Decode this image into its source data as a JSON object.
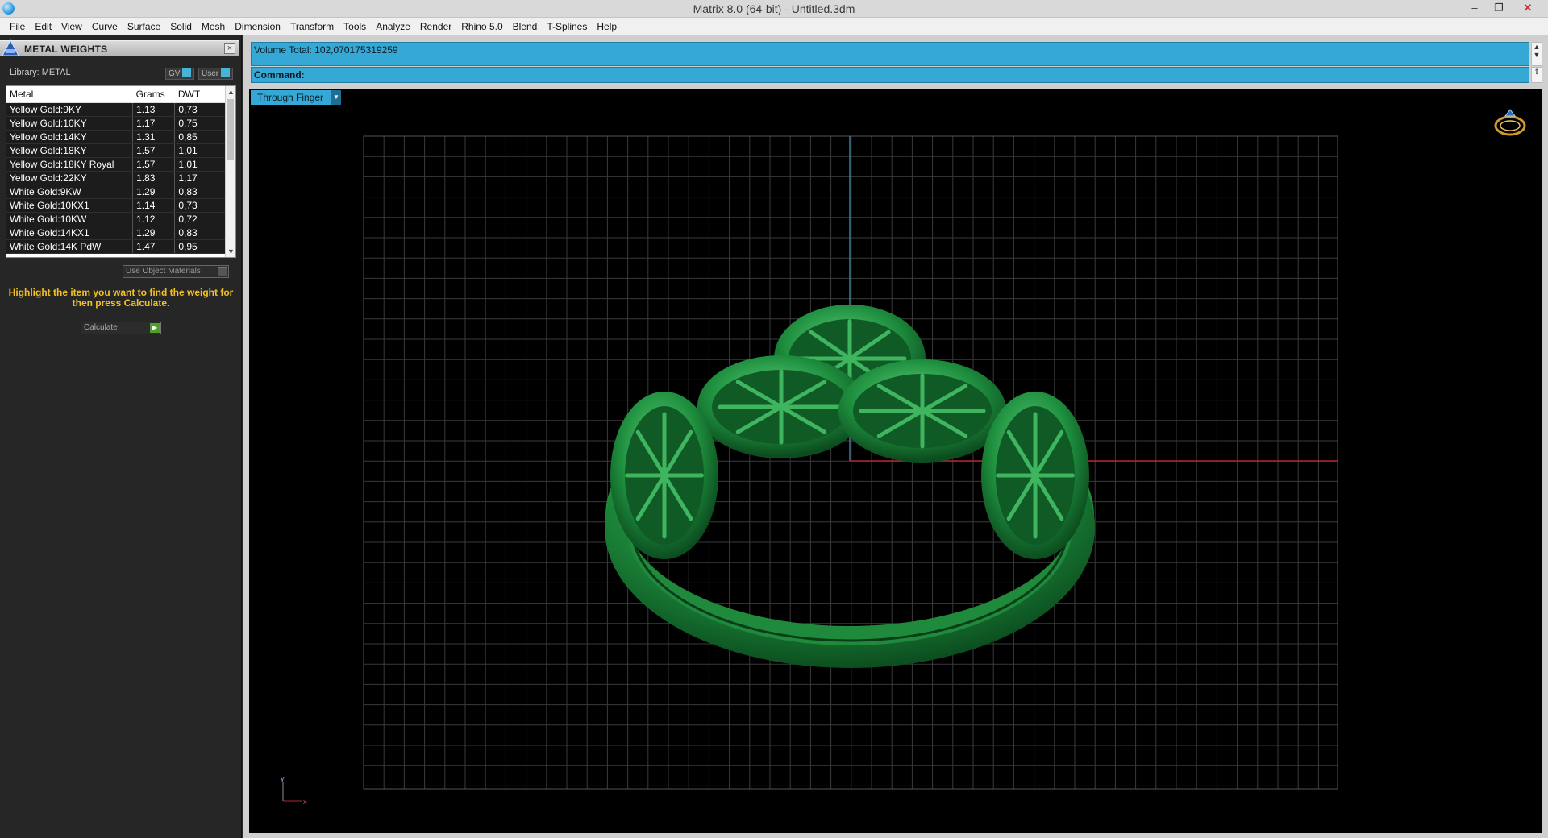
{
  "window": {
    "title": "Matrix 8.0 (64-bit) - Untitled.3dm",
    "minimize": "–",
    "restore": "❐",
    "close": "✕"
  },
  "menu": [
    "File",
    "Edit",
    "View",
    "Curve",
    "Surface",
    "Solid",
    "Mesh",
    "Dimension",
    "Transform",
    "Tools",
    "Analyze",
    "Render",
    "Rhino 5.0",
    "Blend",
    "T-Splines",
    "Help"
  ],
  "panel": {
    "title": "METAL WEIGHTS",
    "library_label": "Library: METAL",
    "gv_label": "GV",
    "user_label": "User",
    "columns": [
      "Metal",
      "Grams",
      "DWT"
    ],
    "rows": [
      {
        "metal": "Yellow Gold:9KY",
        "grams": "1.13",
        "dwt": "0,73"
      },
      {
        "metal": "Yellow Gold:10KY",
        "grams": "1.17",
        "dwt": "0,75"
      },
      {
        "metal": "Yellow Gold:14KY",
        "grams": "1.31",
        "dwt": "0,85"
      },
      {
        "metal": "Yellow Gold:18KY",
        "grams": "1.57",
        "dwt": "1,01"
      },
      {
        "metal": "Yellow Gold:18KY Royal",
        "grams": "1.57",
        "dwt": "1,01"
      },
      {
        "metal": "Yellow Gold:22KY",
        "grams": "1.83",
        "dwt": "1,17"
      },
      {
        "metal": "White Gold:9KW",
        "grams": "1.29",
        "dwt": "0,83"
      },
      {
        "metal": "White Gold:10KX1",
        "grams": "1.14",
        "dwt": "0,73"
      },
      {
        "metal": "White Gold:10KW",
        "grams": "1.12",
        "dwt": "0,72"
      },
      {
        "metal": "White Gold:14KX1",
        "grams": "1.29",
        "dwt": "0,83"
      },
      {
        "metal": "White Gold:14K PdW",
        "grams": "1.47",
        "dwt": "0,95"
      }
    ],
    "use_object_materials": "Use Object Materials",
    "hint": "Highlight the item you want to find the weight for then press Calculate.",
    "calculate": "Calculate"
  },
  "status": {
    "volume": "Volume Total: 102,070175319259",
    "command": "Command:"
  },
  "viewport": {
    "view_name": "Through Finger",
    "axis_y": "y",
    "axis_x": "x"
  },
  "colors": {
    "accent": "#35a8d6",
    "model": "#1e8f3e",
    "grid": "#3a3a3a",
    "x_axis": "#b3262a",
    "y_axis": "#3f7f8f",
    "hint": "#f2c021"
  },
  "icons": {
    "app": "app-icon",
    "panel": "metal-weights-icon",
    "ring": "ring-view-icon",
    "calculate": "play-icon"
  }
}
